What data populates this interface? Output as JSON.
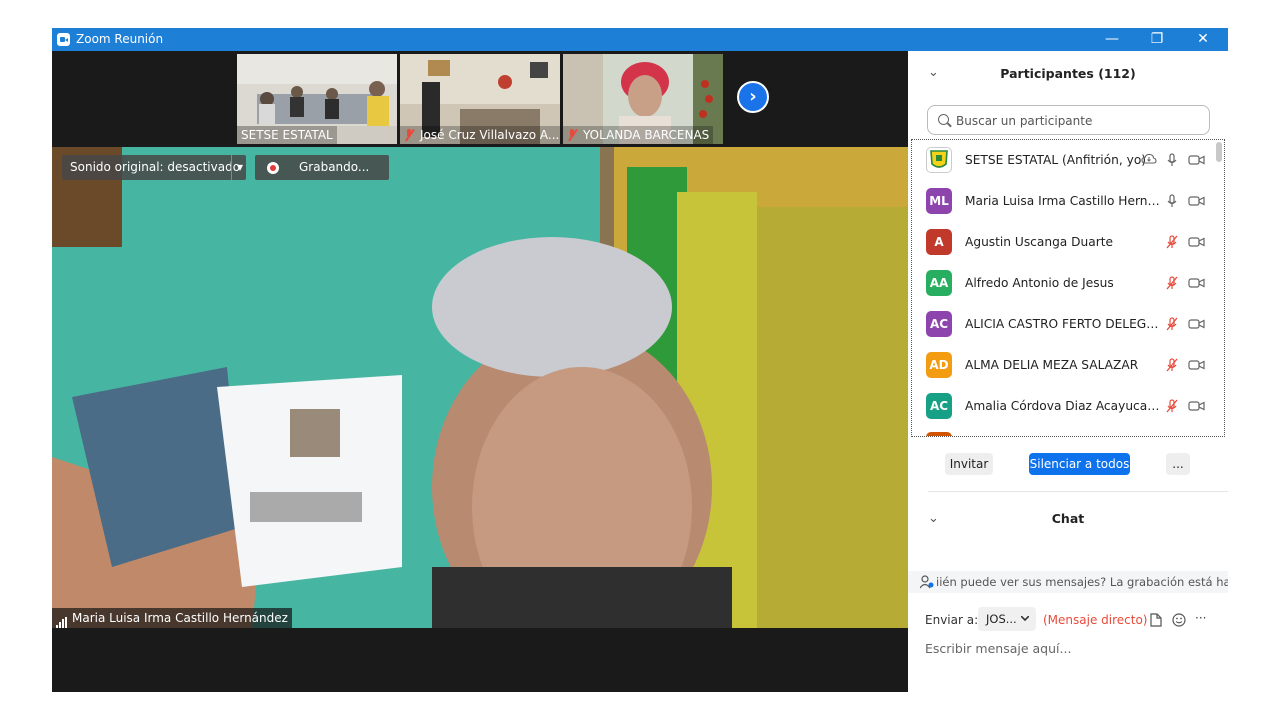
{
  "window": {
    "title": "Zoom Reunión",
    "minimize": "—",
    "restore": "❐",
    "close": "✕"
  },
  "thumbnails": [
    {
      "name": "SETSE ESTATAL",
      "muted": false
    },
    {
      "name": "José Cruz Villalvazo A...",
      "muted": true
    },
    {
      "name": "YOLANDA BARCENAS",
      "muted": true
    }
  ],
  "next_page": "›",
  "main_video": {
    "sound_toggle": "Sonido original: desactivado",
    "dropdown": "▾",
    "recording": "Grabando...",
    "speaker_name": "Maria Luisa Irma Castillo Hernández"
  },
  "participants": {
    "collapse": "⌄",
    "title": "Participantes (112)",
    "search_placeholder": "Buscar un participante",
    "rows": [
      {
        "initials": "",
        "name": "SETSE ESTATAL (Anfitrión, yo)",
        "color": "#ffffff",
        "mic": "on",
        "cloud": true
      },
      {
        "initials": "ML",
        "name": "Maria Luisa Irma Castillo Herná...",
        "color": "#8e44ad",
        "mic": "on"
      },
      {
        "initials": "A",
        "name": "Agustin Uscanga Duarte",
        "color": "#c0392b",
        "mic": "off"
      },
      {
        "initials": "AA",
        "name": "Alfredo Antonio de Jesus",
        "color": "#27ae60",
        "mic": "off"
      },
      {
        "initials": "AC",
        "name": "ALICIA CASTRO FERTO DELEGAC...",
        "color": "#8e44ad",
        "mic": "off"
      },
      {
        "initials": "AD",
        "name": "ALMA DELIA MEZA SALAZAR",
        "color": "#f39c12",
        "mic": "off"
      },
      {
        "initials": "AC",
        "name": "Amalia Córdova Diaz Acayucan ...",
        "color": "#16a085",
        "mic": "off"
      }
    ],
    "invite": "Invitar",
    "mute_all": "Silenciar a todos",
    "more": "..."
  },
  "chat": {
    "collapse": "⌄",
    "title": "Chat",
    "notice": "iién puede ver sus mensajes? La grabación está habilit",
    "send_to_label": "Enviar a:",
    "recipient": "JOS...",
    "direct": "(Mensaje directo)",
    "more": "···",
    "placeholder": "Escribir mensaje aquí..."
  },
  "colors": {
    "titlebar": "#1e7fd6",
    "accent": "#0e72ed",
    "muted": "#e74b3c"
  }
}
